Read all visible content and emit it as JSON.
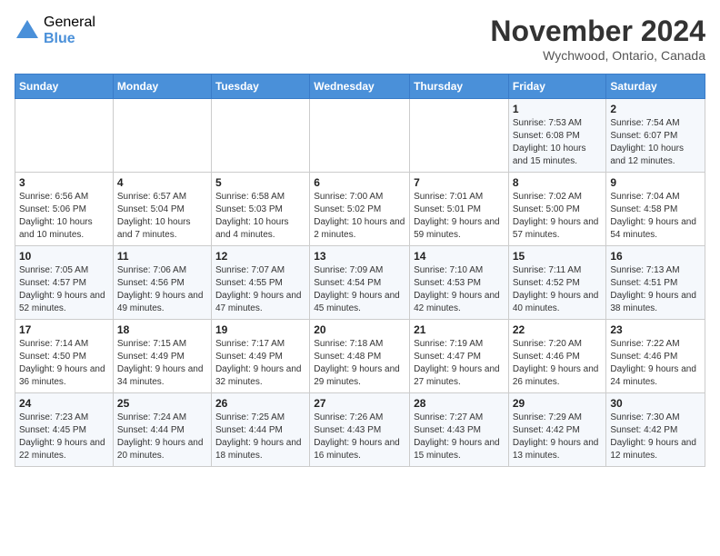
{
  "logo": {
    "general": "General",
    "blue": "Blue"
  },
  "title": "November 2024",
  "location": "Wychwood, Ontario, Canada",
  "days_header": [
    "Sunday",
    "Monday",
    "Tuesday",
    "Wednesday",
    "Thursday",
    "Friday",
    "Saturday"
  ],
  "weeks": [
    [
      {
        "day": "",
        "info": ""
      },
      {
        "day": "",
        "info": ""
      },
      {
        "day": "",
        "info": ""
      },
      {
        "day": "",
        "info": ""
      },
      {
        "day": "",
        "info": ""
      },
      {
        "day": "1",
        "info": "Sunrise: 7:53 AM\nSunset: 6:08 PM\nDaylight: 10 hours and 15 minutes."
      },
      {
        "day": "2",
        "info": "Sunrise: 7:54 AM\nSunset: 6:07 PM\nDaylight: 10 hours and 12 minutes."
      }
    ],
    [
      {
        "day": "3",
        "info": "Sunrise: 6:56 AM\nSunset: 5:06 PM\nDaylight: 10 hours and 10 minutes."
      },
      {
        "day": "4",
        "info": "Sunrise: 6:57 AM\nSunset: 5:04 PM\nDaylight: 10 hours and 7 minutes."
      },
      {
        "day": "5",
        "info": "Sunrise: 6:58 AM\nSunset: 5:03 PM\nDaylight: 10 hours and 4 minutes."
      },
      {
        "day": "6",
        "info": "Sunrise: 7:00 AM\nSunset: 5:02 PM\nDaylight: 10 hours and 2 minutes."
      },
      {
        "day": "7",
        "info": "Sunrise: 7:01 AM\nSunset: 5:01 PM\nDaylight: 9 hours and 59 minutes."
      },
      {
        "day": "8",
        "info": "Sunrise: 7:02 AM\nSunset: 5:00 PM\nDaylight: 9 hours and 57 minutes."
      },
      {
        "day": "9",
        "info": "Sunrise: 7:04 AM\nSunset: 4:58 PM\nDaylight: 9 hours and 54 minutes."
      }
    ],
    [
      {
        "day": "10",
        "info": "Sunrise: 7:05 AM\nSunset: 4:57 PM\nDaylight: 9 hours and 52 minutes."
      },
      {
        "day": "11",
        "info": "Sunrise: 7:06 AM\nSunset: 4:56 PM\nDaylight: 9 hours and 49 minutes."
      },
      {
        "day": "12",
        "info": "Sunrise: 7:07 AM\nSunset: 4:55 PM\nDaylight: 9 hours and 47 minutes."
      },
      {
        "day": "13",
        "info": "Sunrise: 7:09 AM\nSunset: 4:54 PM\nDaylight: 9 hours and 45 minutes."
      },
      {
        "day": "14",
        "info": "Sunrise: 7:10 AM\nSunset: 4:53 PM\nDaylight: 9 hours and 42 minutes."
      },
      {
        "day": "15",
        "info": "Sunrise: 7:11 AM\nSunset: 4:52 PM\nDaylight: 9 hours and 40 minutes."
      },
      {
        "day": "16",
        "info": "Sunrise: 7:13 AM\nSunset: 4:51 PM\nDaylight: 9 hours and 38 minutes."
      }
    ],
    [
      {
        "day": "17",
        "info": "Sunrise: 7:14 AM\nSunset: 4:50 PM\nDaylight: 9 hours and 36 minutes."
      },
      {
        "day": "18",
        "info": "Sunrise: 7:15 AM\nSunset: 4:49 PM\nDaylight: 9 hours and 34 minutes."
      },
      {
        "day": "19",
        "info": "Sunrise: 7:17 AM\nSunset: 4:49 PM\nDaylight: 9 hours and 32 minutes."
      },
      {
        "day": "20",
        "info": "Sunrise: 7:18 AM\nSunset: 4:48 PM\nDaylight: 9 hours and 29 minutes."
      },
      {
        "day": "21",
        "info": "Sunrise: 7:19 AM\nSunset: 4:47 PM\nDaylight: 9 hours and 27 minutes."
      },
      {
        "day": "22",
        "info": "Sunrise: 7:20 AM\nSunset: 4:46 PM\nDaylight: 9 hours and 26 minutes."
      },
      {
        "day": "23",
        "info": "Sunrise: 7:22 AM\nSunset: 4:46 PM\nDaylight: 9 hours and 24 minutes."
      }
    ],
    [
      {
        "day": "24",
        "info": "Sunrise: 7:23 AM\nSunset: 4:45 PM\nDaylight: 9 hours and 22 minutes."
      },
      {
        "day": "25",
        "info": "Sunrise: 7:24 AM\nSunset: 4:44 PM\nDaylight: 9 hours and 20 minutes."
      },
      {
        "day": "26",
        "info": "Sunrise: 7:25 AM\nSunset: 4:44 PM\nDaylight: 9 hours and 18 minutes."
      },
      {
        "day": "27",
        "info": "Sunrise: 7:26 AM\nSunset: 4:43 PM\nDaylight: 9 hours and 16 minutes."
      },
      {
        "day": "28",
        "info": "Sunrise: 7:27 AM\nSunset: 4:43 PM\nDaylight: 9 hours and 15 minutes."
      },
      {
        "day": "29",
        "info": "Sunrise: 7:29 AM\nSunset: 4:42 PM\nDaylight: 9 hours and 13 minutes."
      },
      {
        "day": "30",
        "info": "Sunrise: 7:30 AM\nSunset: 4:42 PM\nDaylight: 9 hours and 12 minutes."
      }
    ]
  ]
}
